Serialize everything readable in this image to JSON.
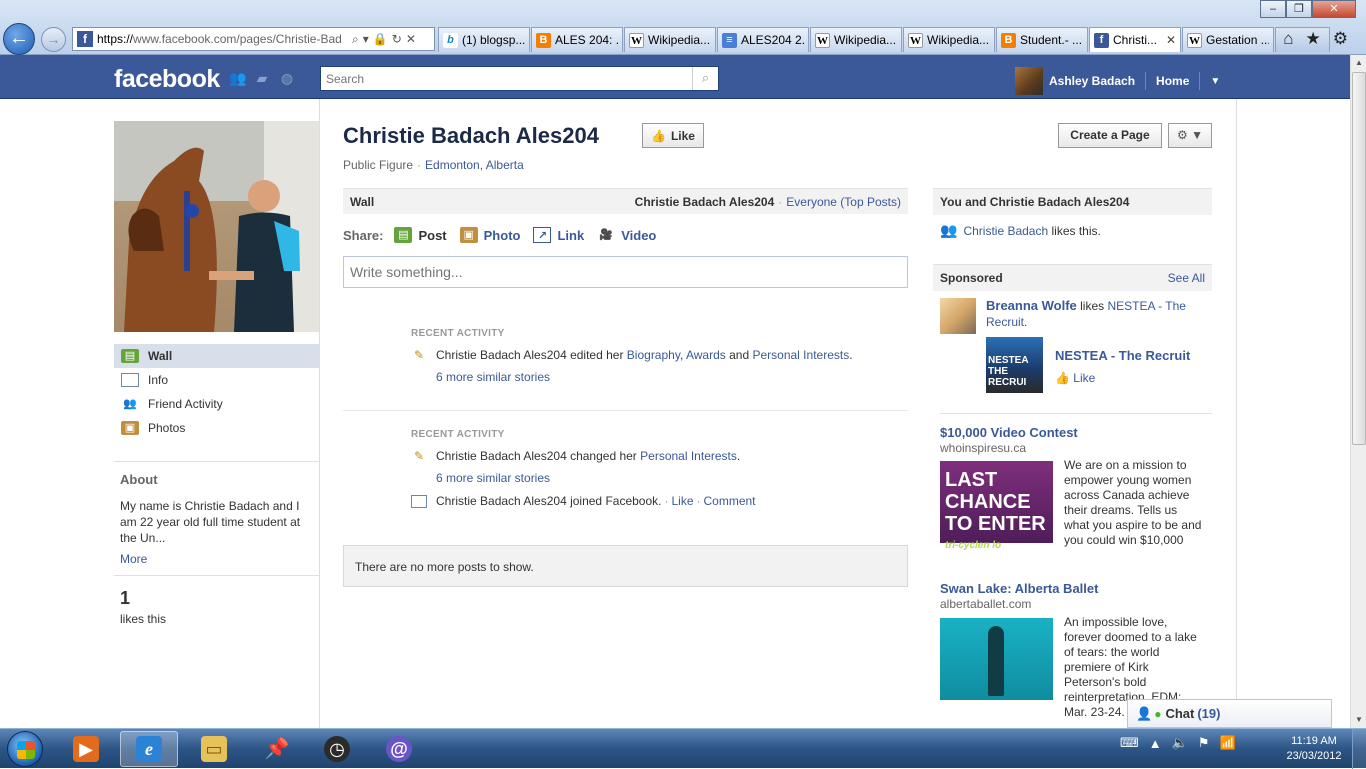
{
  "browser": {
    "url_https": "https://",
    "url_rest": "www.facebook.com/pages/Christie-Bad",
    "tabs": [
      {
        "icon": "bing-icon",
        "label": "(1) blogsp..."
      },
      {
        "icon": "blogger-icon",
        "label": "ALES 204: ..."
      },
      {
        "icon": "wikipedia-icon",
        "label": "Wikipedia..."
      },
      {
        "icon": "document-icon",
        "label": "ALES204 2..."
      },
      {
        "icon": "wikipedia-icon",
        "label": "Wikipedia..."
      },
      {
        "icon": "wikipedia-icon",
        "label": "Wikipedia..."
      },
      {
        "icon": "blogger-icon",
        "label": "Student.- ..."
      },
      {
        "icon": "facebook-icon",
        "label": "Christi...",
        "active": true
      },
      {
        "icon": "wikipedia-icon",
        "label": "Gestation ..."
      }
    ]
  },
  "fb": {
    "logo": "facebook",
    "search_placeholder": "Search",
    "user_name": "Ashley Badach",
    "home_label": "Home"
  },
  "left": {
    "nav": [
      {
        "label": "Wall",
        "icon": "wall-icon",
        "selected": true
      },
      {
        "label": "Info",
        "icon": "info-icon"
      },
      {
        "label": "Friend Activity",
        "icon": "friends-icon"
      },
      {
        "label": "Photos",
        "icon": "photos-icon"
      }
    ],
    "about_title": "About",
    "about_text": "My name is Christie Badach and I am 22 year old full time student at the Un...",
    "about_more": "More",
    "likes_count": "1",
    "likes_label": "likes this"
  },
  "page": {
    "title": "Christie Badach Ales204",
    "like_label": "Like",
    "category": "Public Figure",
    "location": "Edmonton, Alberta",
    "create_page": "Create a Page"
  },
  "wall": {
    "title": "Wall",
    "owner": "Christie Badach Ales204",
    "filter": "Everyone (Top Posts)",
    "share_label": "Share:",
    "share_post": "Post",
    "share_photo": "Photo",
    "share_link": "Link",
    "share_video": "Video",
    "composer_placeholder": "Write something...",
    "activity1": {
      "head": "RECENT ACTIVITY",
      "actor": "Christie Badach Ales204 edited her",
      "l1": "Biography",
      "sep1": ",",
      "l2": "Awards",
      "and": "and",
      "l3": "Personal Interests",
      "end": ".",
      "more": "6 more similar stories"
    },
    "activity2": {
      "head": "RECENT ACTIVITY",
      "actor": "Christie Badach Ales204 changed her",
      "l1": "Personal Interests",
      "end": ".",
      "more": "6 more similar stories",
      "joined": "Christie Badach Ales204 joined Facebook.",
      "like": "Like",
      "comment": "Comment"
    },
    "no_more": "There are no more posts to show."
  },
  "right": {
    "you_and": "You and Christie Badach Ales204",
    "friend_name": "Christie Badach",
    "friend_likes": "likes this.",
    "sponsored": "Sponsored",
    "see_all": "See All",
    "social_ad": {
      "person": "Breanna Wolfe",
      "likes": "likes",
      "page": "NESTEA - The Recruit",
      "end": ".",
      "img_text": "NESTEA THE RECRUI",
      "name": "NESTEA - The Recruit",
      "like": "Like"
    },
    "ad1": {
      "title": "$10,000 Video Contest",
      "domain": "whoinspiresu.ca",
      "img_line1": "LAST CHANCE",
      "img_line2": "TO ENTER",
      "img_sub": "tri-cyclen lo",
      "body": "We are on a mission to empower young women across Canada achieve their dreams. Tells us what you aspire to be and you could win $10,000"
    },
    "ad2": {
      "title": "Swan Lake: Alberta Ballet",
      "domain": "albertaballet.com",
      "body": "An impossible love, forever doomed to a lake of tears: the world premiere of Kirk Peterson's bold reinterpretation. EDM: Mar. 23-24."
    }
  },
  "chat": {
    "label": "Chat",
    "count": "(19)"
  },
  "taskbar": {
    "time": "11:19 AM",
    "date": "23/03/2012"
  },
  "colors": {
    "fb_blue": "#3b5998",
    "link": "#3b5998",
    "header_bg": "#f2f2f2"
  }
}
